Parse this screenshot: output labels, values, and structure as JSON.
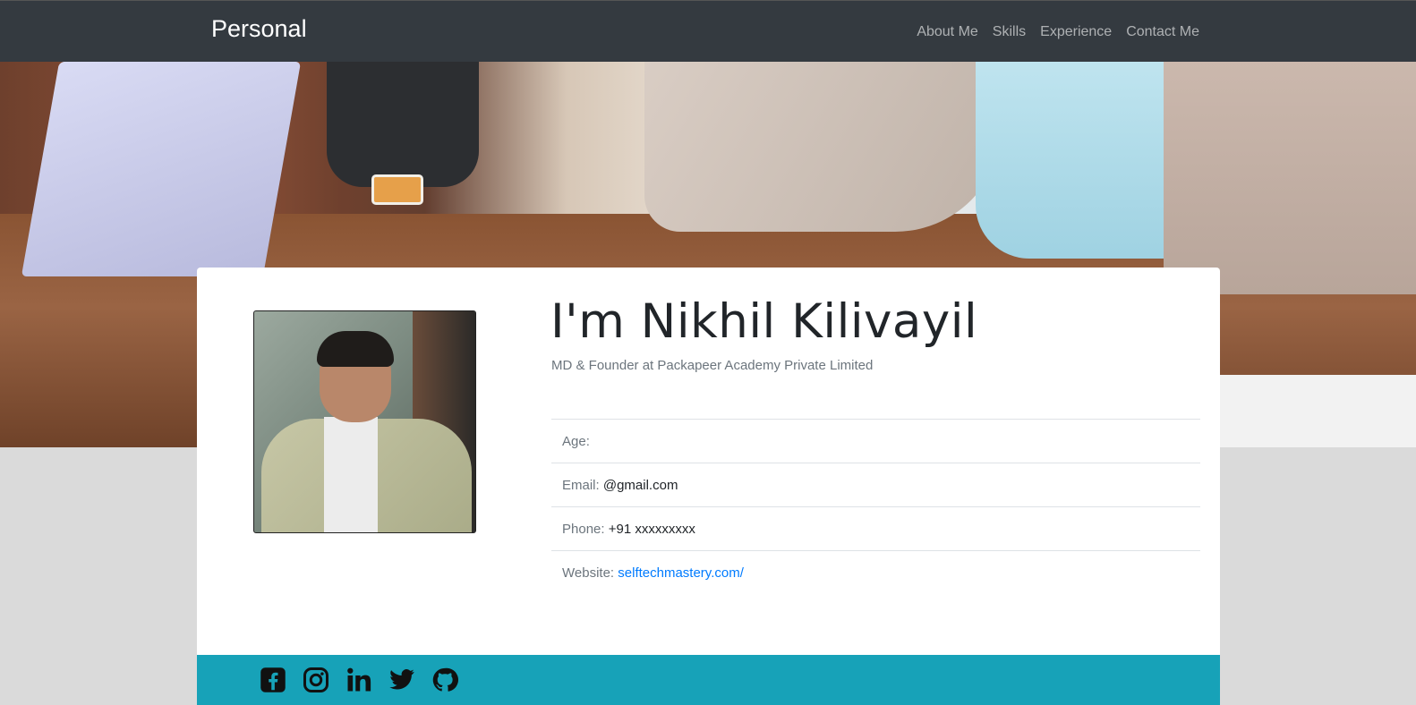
{
  "navbar": {
    "brand": "Personal",
    "links": [
      "About Me",
      "Skills",
      "Experience",
      "Contact Me"
    ]
  },
  "profile": {
    "name": "I'm Nikhil Kilivayil",
    "subtitle": "MD & Founder at Packapeer Academy Private Limited",
    "age_label": "Age:",
    "age_value": "",
    "email_label": "Email:",
    "email_value": "@gmail.com",
    "phone_label": "Phone:",
    "phone_value": "+91 xxxxxxxxx",
    "website_label": "Website:",
    "website_value": "selftechmastery.com/"
  },
  "social": {
    "icons": [
      "facebook-icon",
      "instagram-icon",
      "linkedin-icon",
      "twitter-icon",
      "github-icon"
    ]
  },
  "colors": {
    "navbar_bg": "#343a40",
    "social_bar": "#17a2b8",
    "link": "#007bff",
    "page_bg": "#dadada"
  }
}
